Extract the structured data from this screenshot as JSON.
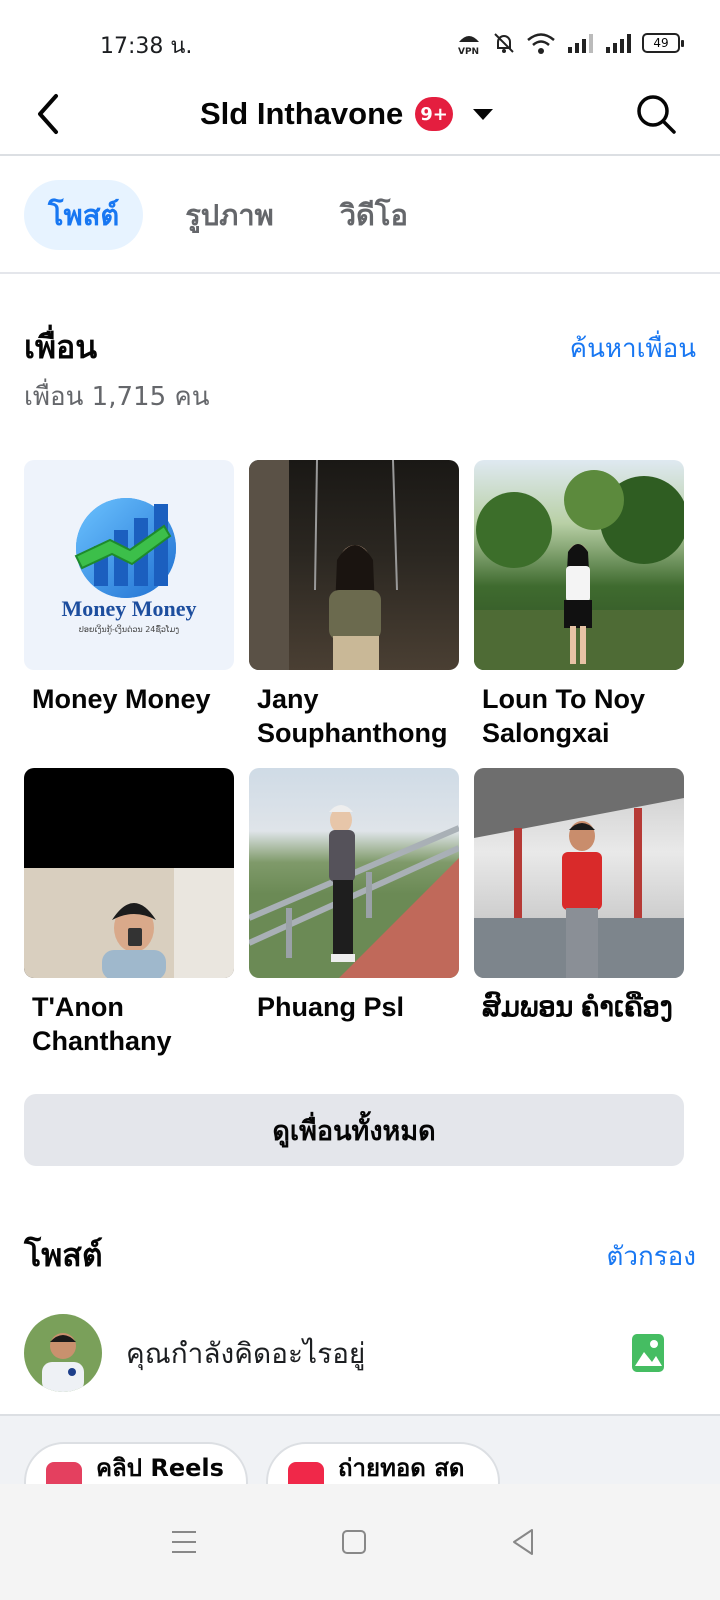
{
  "status_bar": {
    "time": "17:38 น.",
    "battery": "49",
    "icons": [
      "vpn-icon",
      "bell-off-icon",
      "wifi-icon",
      "signal-icon",
      "signal-icon",
      "battery-icon"
    ]
  },
  "header": {
    "name": "Sld Inthavone",
    "badge": "9+",
    "icons": [
      "chevron-left-icon",
      "caret-down-icon",
      "search-icon"
    ]
  },
  "tabs": [
    {
      "label": "โพสต์",
      "active": true
    },
    {
      "label": "รูปภาพ",
      "active": false
    },
    {
      "label": "วิดีโอ",
      "active": false
    }
  ],
  "friends": {
    "title": "เพื่อน",
    "find_link": "ค้นหาเพื่อน",
    "count": "เพื่อน 1,715 คน",
    "see_all": "ดูเพื่อนทั้งหมด",
    "list": [
      {
        "name": "Money Money",
        "logo_text": "Money Money",
        "logo_subtext": "ປອຍເງິນກູ້-ເງິນດ່ວນ 24ຊົ່ວໂມງ"
      },
      {
        "name": "Jany Souphanthong"
      },
      {
        "name": "Loun To Noy Salongxai"
      },
      {
        "name": "T'Anon Chanthany"
      },
      {
        "name": "Phuang Psl"
      },
      {
        "name": "ສົມພອນ ຄຳເຄືອງ"
      }
    ]
  },
  "posts": {
    "title": "โพสต์",
    "filter_link": "ตัวกรอง",
    "composer_placeholder": "คุณกำลังคิดอะไรอยู่",
    "chips": [
      {
        "label": "คลิป Reels",
        "icon": "reels-icon"
      },
      {
        "label": "ถ่ายทอด สด",
        "icon": "live-video-icon"
      }
    ]
  },
  "nav_bar": {
    "icons": [
      "menu-icon",
      "home-square-icon",
      "back-triangle-icon"
    ]
  },
  "colors": {
    "accent": "#1877f2",
    "badge": "#e41e3f",
    "tab_active_bg": "#e7f3ff",
    "button_bg": "#e4e6eb",
    "photo_icon": "#45bd62"
  }
}
